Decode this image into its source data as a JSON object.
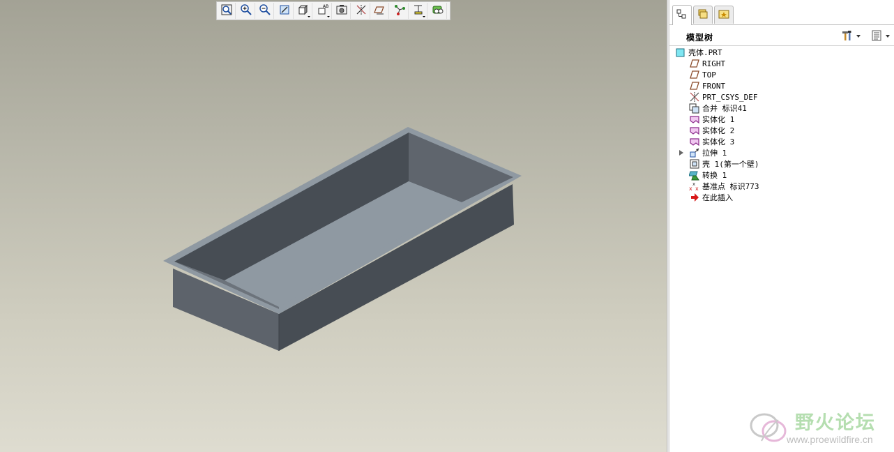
{
  "colors": {
    "viewport_top": "#a3a295",
    "viewport_bottom": "#dedcd0",
    "model_rim": "#8f99a2",
    "model_inner_wall_dark": "#474d54",
    "model_inner_wall_light": "#5f656d",
    "model_floor": "#8f99a2",
    "model_outer_wall_front": "#474d54",
    "model_outer_wall_side": "#5d636b"
  },
  "toolbar": {
    "buttons": [
      {
        "icon": "zoom-fit-icon"
      },
      {
        "icon": "zoom-in-icon"
      },
      {
        "icon": "zoom-out-icon"
      },
      {
        "icon": "repaint-icon"
      },
      {
        "icon": "shading-icon"
      },
      {
        "icon": "saved-views-icon"
      },
      {
        "icon": "layers-camera-icon"
      },
      {
        "icon": "datum-planes-icon"
      },
      {
        "icon": "datum-axes-icon"
      },
      {
        "icon": "datum-points-icon"
      },
      {
        "icon": "coordinate-system-icon"
      },
      {
        "icon": "annotations-icon"
      }
    ]
  },
  "panel": {
    "tabs": [
      {
        "icon": "model-tree-tab-icon",
        "active": true
      },
      {
        "icon": "folder-browser-tab-icon",
        "active": false
      },
      {
        "icon": "favorites-tab-icon",
        "active": false
      }
    ],
    "header": {
      "title": "模型树",
      "settings_icon": "tools-icon",
      "show_icon": "list-icon"
    },
    "tree": [
      {
        "label": "壳体.PRT",
        "icon": "part-icon",
        "level": 0
      },
      {
        "label": "RIGHT",
        "icon": "datum-plane-icon",
        "level": 1
      },
      {
        "label": "TOP",
        "icon": "datum-plane-icon",
        "level": 1
      },
      {
        "label": "FRONT",
        "icon": "datum-plane-icon",
        "level": 1
      },
      {
        "label": "PRT_CSYS_DEF",
        "icon": "csys-icon",
        "level": 1
      },
      {
        "label": "合并 标识41",
        "icon": "merge-icon",
        "level": 1
      },
      {
        "label": "实体化 1",
        "icon": "solidify-icon",
        "level": 1
      },
      {
        "label": "实体化 2",
        "icon": "solidify-icon",
        "level": 1
      },
      {
        "label": "实体化 3",
        "icon": "solidify-icon",
        "level": 1
      },
      {
        "label": "拉伸 1",
        "icon": "extrude-icon",
        "level": 1,
        "expandable": true
      },
      {
        "label": "壳 1(第一个壁)",
        "icon": "shell-icon",
        "level": 1
      },
      {
        "label": "转换 1",
        "icon": "convert-icon",
        "level": 1
      },
      {
        "label": "基准点 标识773",
        "icon": "datum-point-icon",
        "level": 1
      },
      {
        "label": "在此插入",
        "icon": "insert-here-icon",
        "level": 1
      }
    ]
  },
  "watermark": {
    "text_cn": "野火论坛",
    "url": "www.proewildfire.cn"
  }
}
